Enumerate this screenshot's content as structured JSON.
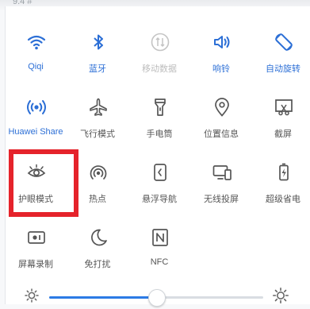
{
  "status_bar": {
    "text": "9.4 #"
  },
  "tiles": [
    {
      "label": "Qiqi",
      "state": "on",
      "icon": "wifi-icon"
    },
    {
      "label": "蓝牙",
      "state": "on",
      "icon": "bluetooth-icon"
    },
    {
      "label": "移动数据",
      "state": "dim",
      "icon": "mobile-data-icon"
    },
    {
      "label": "响铃",
      "state": "on",
      "icon": "ring-volume-icon"
    },
    {
      "label": "自动旋转",
      "state": "on",
      "icon": "auto-rotate-icon"
    },
    {
      "label": "Huawei Share",
      "state": "on",
      "icon": "huawei-share-icon"
    },
    {
      "label": "飞行模式",
      "state": "off",
      "icon": "airplane-icon"
    },
    {
      "label": "手电筒",
      "state": "off",
      "icon": "flashlight-icon"
    },
    {
      "label": "位置信息",
      "state": "off",
      "icon": "location-icon"
    },
    {
      "label": "截屏",
      "state": "off",
      "icon": "screenshot-icon"
    },
    {
      "label": "护眼模式",
      "state": "off",
      "icon": "eye-comfort-icon"
    },
    {
      "label": "热点",
      "state": "off",
      "icon": "hotspot-icon"
    },
    {
      "label": "悬浮导航",
      "state": "off",
      "icon": "floating-nav-icon"
    },
    {
      "label": "无线投屏",
      "state": "off",
      "icon": "wireless-projection-icon"
    },
    {
      "label": "超级省电",
      "state": "off",
      "icon": "ultra-power-saving-icon"
    },
    {
      "label": "屏幕录制",
      "state": "off",
      "icon": "screen-record-icon"
    },
    {
      "label": "免打扰",
      "state": "off",
      "icon": "do-not-disturb-icon"
    },
    {
      "label": "NFC",
      "state": "off",
      "icon": "nfc-icon"
    }
  ],
  "highlighted_tile": "护眼模式",
  "brightness": {
    "level": 0.5,
    "icon_left": "sun-small-icon",
    "icon_right": "sun-large-icon"
  },
  "colors": {
    "accent": "#2c6fd6",
    "highlight": "#e5232b",
    "inactive_icon": "#555555",
    "dim": "#bdbdbd"
  }
}
